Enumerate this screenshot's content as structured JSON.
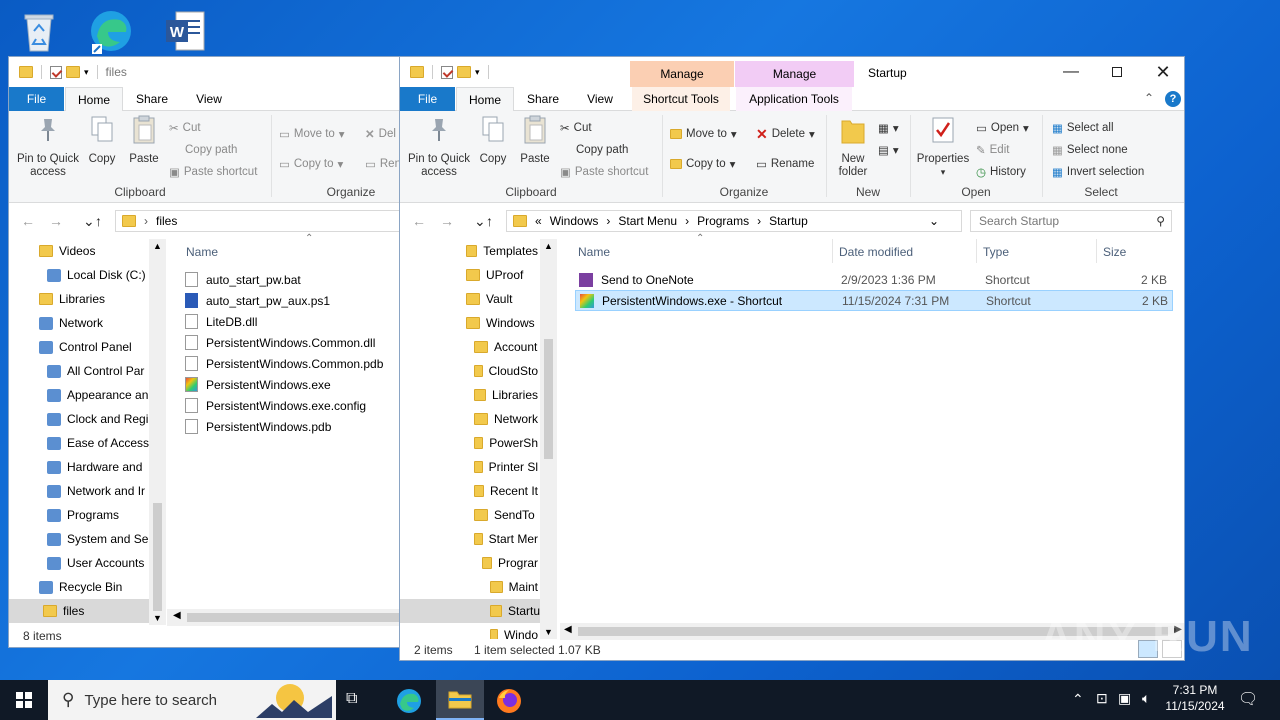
{
  "desktop": {
    "icons": [
      "recycle-bin-icon",
      "edge-icon",
      "word-icon"
    ]
  },
  "left_window": {
    "title": "files",
    "tabs": {
      "file": "File",
      "home": "Home",
      "share": "Share",
      "view": "View"
    },
    "ribbon": {
      "pin": "Pin to Quick access",
      "copy": "Copy",
      "paste": "Paste",
      "cut": "Cut",
      "copy_path": "Copy path",
      "paste_shortcut": "Paste shortcut",
      "clipboard": "Clipboard",
      "move_to": "Move to",
      "copy_to": "Copy to",
      "delete": "Del",
      "rename": "Ren",
      "organize": "Organize"
    },
    "address": {
      "path": "files"
    },
    "nav": [
      "Videos",
      "Local Disk (C:)",
      "Libraries",
      "Network",
      "Control Panel",
      "All Control Par",
      "Appearance an",
      "Clock and Regi",
      "Ease of Access",
      "Hardware and",
      "Network and Ir",
      "Programs",
      "System and Se",
      "User Accounts",
      "Recycle Bin",
      "files"
    ],
    "column_name": "Name",
    "files": [
      "auto_start_pw.bat",
      "auto_start_pw_aux.ps1",
      "LiteDB.dll",
      "PersistentWindows.Common.dll",
      "PersistentWindows.Common.pdb",
      "PersistentWindows.exe",
      "PersistentWindows.exe.config",
      "PersistentWindows.pdb"
    ],
    "status": "8 items"
  },
  "right_window": {
    "title": "Startup",
    "manage1": "Manage",
    "manage2": "Manage",
    "shortcut_tools": "Shortcut Tools",
    "application_tools": "Application Tools",
    "tabs": {
      "file": "File",
      "home": "Home",
      "share": "Share",
      "view": "View"
    },
    "ribbon": {
      "pin": "Pin to Quick access",
      "copy": "Copy",
      "paste": "Paste",
      "cut": "Cut",
      "copy_path": "Copy path",
      "paste_shortcut": "Paste shortcut",
      "clipboard": "Clipboard",
      "move_to": "Move to",
      "copy_to": "Copy to",
      "delete": "Delete",
      "rename": "Rename",
      "organize": "Organize",
      "new_folder": "New folder",
      "new": "New",
      "properties": "Properties",
      "open": "Open",
      "edit": "Edit",
      "history": "History",
      "open_group": "Open",
      "select_all": "Select all",
      "select_none": "Select none",
      "invert_selection": "Invert selection",
      "select": "Select"
    },
    "address": {
      "prefix": "«",
      "parts": [
        "Windows",
        "Start Menu",
        "Programs",
        "Startup"
      ],
      "search_placeholder": "Search Startup"
    },
    "nav": [
      "Templates",
      "UProof",
      "Vault",
      "Windows",
      "Account",
      "CloudSto",
      "Libraries",
      "Network",
      "PowerSh",
      "Printer Sl",
      "Recent It",
      "SendTo",
      "Start Mer",
      "Prograr",
      "Maint",
      "Startu",
      "Windo"
    ],
    "columns": {
      "name": "Name",
      "date": "Date modified",
      "type": "Type",
      "size": "Size"
    },
    "files": [
      {
        "name": "Send to OneNote",
        "date": "2/9/2023 1:36 PM",
        "type": "Shortcut",
        "size": "2 KB"
      },
      {
        "name": "PersistentWindows.exe - Shortcut",
        "date": "11/15/2024 7:31 PM",
        "type": "Shortcut",
        "size": "2 KB"
      }
    ],
    "status": {
      "items": "2 items",
      "selected": "1 item selected",
      "size": "1.07 KB"
    }
  },
  "watermark": "ANY RUN",
  "taskbar": {
    "search_placeholder": "Type here to search",
    "time": "7:31 PM",
    "date": "11/15/2024"
  },
  "colors": {
    "accent": "#1979ca",
    "selection": "#cce8ff",
    "desktop": "#0d62cf",
    "taskbar": "#101926",
    "manage_shortcut": "#fbcfb3",
    "manage_app": "#f2ccf5"
  }
}
